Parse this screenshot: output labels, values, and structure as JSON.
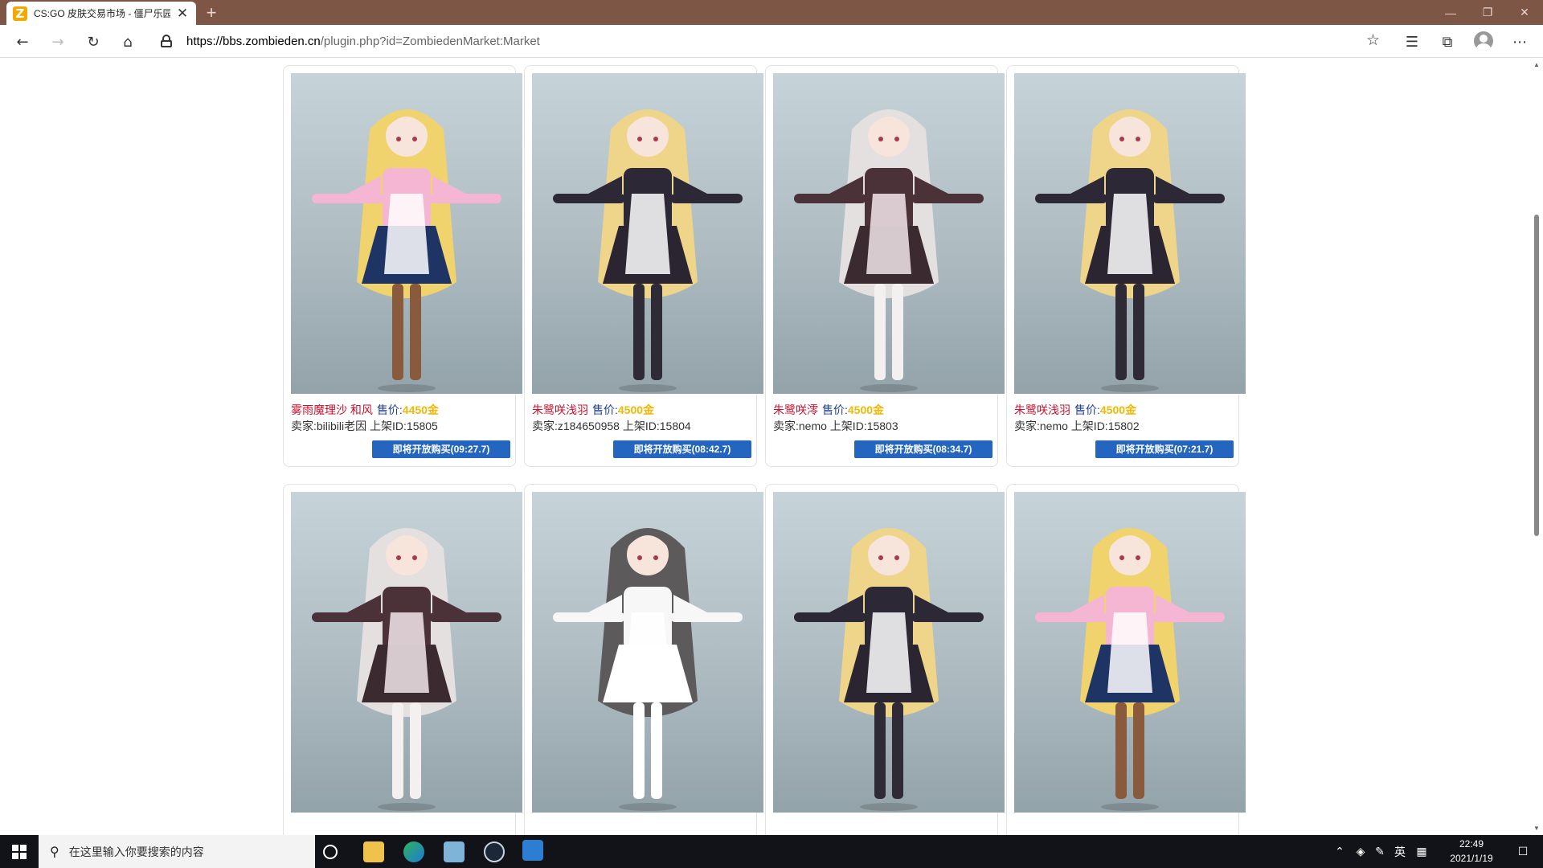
{
  "browser": {
    "tab_title": "CS:GO 皮肤交易市场 - 僵尸乐园",
    "tab_favicon": "Z",
    "tab_close": "✕",
    "new_tab": "+",
    "url_host": "https://bbs.zombieden.cn",
    "url_path": "/plugin.php?id=ZombiedenMarket:Market",
    "window_controls": [
      "—",
      "❐",
      "✕"
    ]
  },
  "toolbar_icons": [
    "back-icon",
    "forward-icon",
    "refresh-icon",
    "home-icon",
    "lock-icon",
    "star-icon",
    "favorites-icon",
    "collections-icon",
    "profile-icon",
    "more-icon"
  ],
  "listings": [
    {
      "name": "雾雨魔理沙 和风",
      "price_label": "售价:",
      "price": "4450金",
      "seller_line": "卖家:bilibili老因 上架ID:15805",
      "button": "即将开放购买(09:27.7)",
      "figure": {
        "hair": "#f0d36c",
        "top": "#f4b6d2",
        "skirt": "#1e3465",
        "apron": "#ffffff",
        "legs": "#8a5a3c"
      }
    },
    {
      "name": "朱鹭咲浅羽",
      "price_label": "售价:",
      "price": "4500金",
      "seller_line": "卖家:z184650958 上架ID:15804",
      "button": "即将开放购买(08:42.7)",
      "figure": {
        "hair": "#efd58a",
        "top": "#2d2836",
        "skirt": "#2b2532",
        "apron": "#ffffff",
        "legs": "#2e2a36"
      }
    },
    {
      "name": "朱鹭咲澪",
      "price_label": "售价:",
      "price": "4500金",
      "seller_line": "卖家:nemo 上架ID:15803",
      "button": "即将开放购买(08:34.7)",
      "figure": {
        "hair": "#e3e0df",
        "top": "#4a3238",
        "skirt": "#3b2a30",
        "apron": "#f2e6ea",
        "legs": "#f4f0ef"
      }
    },
    {
      "name": "朱鹭咲浅羽",
      "price_label": "售价:",
      "price": "4500金",
      "seller_line": "卖家:nemo 上架ID:15802",
      "button": "即将开放购买(07:21.7)",
      "figure": {
        "hair": "#efd58a",
        "top": "#2d2836",
        "skirt": "#2b2532",
        "apron": "#ffffff",
        "legs": "#2e2a36"
      }
    },
    {
      "name": "",
      "price_label": "",
      "price": "",
      "seller_line": "",
      "button": "",
      "figure": {
        "hair": "#e3e0df",
        "top": "#4a3238",
        "skirt": "#3b2a30",
        "apron": "#f2e6ea",
        "legs": "#f4f0ef"
      }
    },
    {
      "name": "",
      "price_label": "",
      "price": "",
      "seller_line": "",
      "button": "",
      "figure": {
        "hair": "#5c5a5a",
        "top": "#f7f7f7",
        "skirt": "#ffffff",
        "apron": "#ffffff",
        "legs": "#ffffff"
      }
    },
    {
      "name": "",
      "price_label": "",
      "price": "",
      "seller_line": "",
      "button": "",
      "figure": {
        "hair": "#efd58a",
        "top": "#2d2836",
        "skirt": "#2b2532",
        "apron": "#ffffff",
        "legs": "#2e2a36"
      }
    },
    {
      "name": "",
      "price_label": "",
      "price": "",
      "seller_line": "",
      "button": "",
      "figure": {
        "hair": "#f0d36c",
        "top": "#f4b6d2",
        "skirt": "#1e3465",
        "apron": "#ffffff",
        "legs": "#8a5a3c"
      }
    }
  ],
  "taskbar": {
    "search_placeholder": "在这里输入你要搜索的内容",
    "apps": [
      "task-view-icon",
      "file-explorer-icon",
      "edge-icon",
      "app-icon",
      "steam-icon",
      "remote-desktop-icon"
    ],
    "tray_ime": "英",
    "time": "22:49",
    "date": "2021/1/19"
  },
  "colors": {
    "titlebar": "#7e5646",
    "name": "#c8102e",
    "price_label": "#1f3f93",
    "price": "#f2b705",
    "button": "#2365bf",
    "taskbar": "#111318"
  }
}
